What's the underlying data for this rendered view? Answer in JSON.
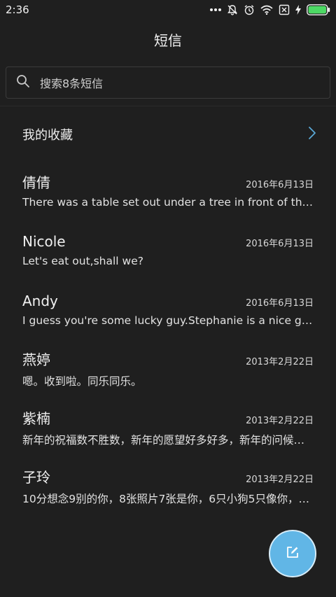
{
  "status_bar": {
    "time": "2:36",
    "icons": [
      "more-dots-icon",
      "mute-bell-icon",
      "alarm-icon",
      "wifi-icon",
      "sim-x-icon",
      "charging-bolt-icon",
      "battery-icon"
    ],
    "battery_color": "#4cd964"
  },
  "header": {
    "title": "短信"
  },
  "search": {
    "placeholder": "搜索8条短信",
    "icon": "search-icon"
  },
  "favorites": {
    "label": "我的收藏",
    "icon": "chevron-right-icon",
    "chevron_color": "#5aa9d6"
  },
  "messages": [
    {
      "name": "倩倩",
      "date": "2016年6月13日",
      "snippet": "There was a table set out under a tree in front of the ho…"
    },
    {
      "name": "Nicole",
      "date": "2016年6月13日",
      "snippet": "Let's eat out,shall we?"
    },
    {
      "name": "Andy",
      "date": "2016年6月13日",
      "snippet": "I guess you're some lucky guy.Stephanie is a nice girl."
    },
    {
      "name": "燕婷",
      "date": "2013年2月22日",
      "snippet": "嗯。收到啦。同乐同乐。"
    },
    {
      "name": "紫楠",
      "date": "2013年2月22日",
      "snippet": "新年的祝福数不胜数，新年的愿望好多好多，新年的问候…"
    },
    {
      "name": "子玲",
      "date": "2013年2月22日",
      "snippet": "10分想念9别的你，8张照片7张是你，6只小狗5只像你，4…"
    }
  ],
  "compose": {
    "icon": "compose-icon",
    "color": "#61b6e6"
  }
}
